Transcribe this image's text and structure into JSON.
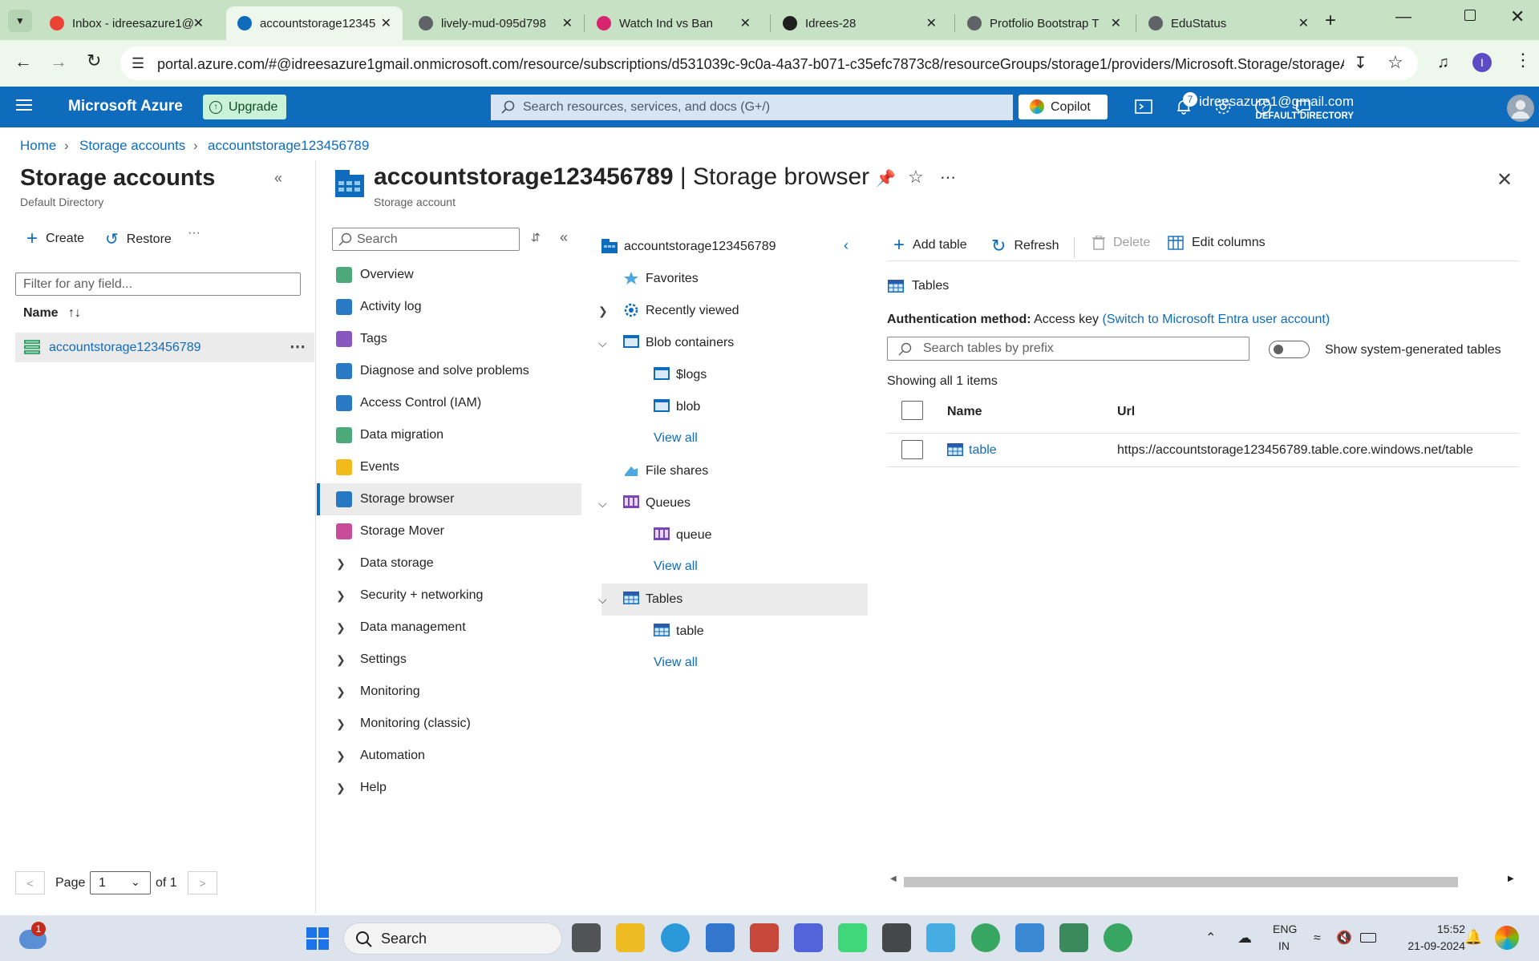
{
  "browser": {
    "tabs": [
      {
        "title": "Inbox - idreesazure1@",
        "fav_color": "#ea4335",
        "active": false
      },
      {
        "title": "accountstorage12345",
        "fav_color": "#0f6cbd",
        "active": true
      },
      {
        "title": "lively-mud-095d798",
        "fav_color": "#5f6368",
        "active": false
      },
      {
        "title": "Watch Ind vs Ban",
        "fav_color": "#d6246e",
        "active": false
      },
      {
        "title": "Idrees-28",
        "fav_color": "#1f1f1f",
        "active": false
      },
      {
        "title": "Protfolio Bootstrap T",
        "fav_color": "#5f6368",
        "active": false
      },
      {
        "title": "EduStatus",
        "fav_color": "#5f6368",
        "active": false
      }
    ],
    "url": "portal.azure.com/#@idreesazure1gmail.onmicrosoft.com/resource/subscriptions/d531039c-9c0a-4a37-b071-c35efc7873c8/resourceGroups/storage1/providers/Microsoft.Storage/storageAcc...",
    "profile_initial": "I"
  },
  "azure": {
    "brand": "Microsoft Azure",
    "upgrade_label": "Upgrade",
    "search_placeholder": "Search resources, services, and docs (G+/)",
    "copilot_label": "Copilot",
    "notification_count": "7",
    "user_email": "idreesazure1@gmail.com",
    "user_directory": "DEFAULT DIRECTORY"
  },
  "breadcrumb": [
    "Home",
    "Storage accounts",
    "accountstorage123456789"
  ],
  "left_panel": {
    "title": "Storage accounts",
    "subtitle": "Default Directory",
    "create_label": "Create",
    "restore_label": "Restore",
    "more_label": "···",
    "filter_placeholder": "Filter for any field...",
    "column_name": "Name",
    "items": [
      "accountstorage123456789"
    ],
    "pagination": {
      "prev": "<",
      "page_label": "Page",
      "page_value": "1",
      "of_label": "of 1",
      "next": ">"
    }
  },
  "resource": {
    "name": "accountstorage123456789",
    "blade": "| Storage browser",
    "type": "Storage account"
  },
  "menu": {
    "search_placeholder": "Search",
    "items": [
      {
        "label": "Overview",
        "icon": "overview-icon",
        "color": "#3a9e6b",
        "expandable": false
      },
      {
        "label": "Activity log",
        "icon": "activity-log-icon",
        "color": "#0f6cbd",
        "expandable": false
      },
      {
        "label": "Tags",
        "icon": "tag-icon",
        "color": "#7a45b8",
        "expandable": false
      },
      {
        "label": "Diagnose and solve problems",
        "icon": "wrench-icon",
        "color": "#0f6cbd",
        "expandable": false
      },
      {
        "label": "Access Control (IAM)",
        "icon": "iam-icon",
        "color": "#0f6cbd",
        "expandable": false
      },
      {
        "label": "Data migration",
        "icon": "data-migration-icon",
        "color": "#3a9e6b",
        "expandable": false
      },
      {
        "label": "Events",
        "icon": "lightning-icon",
        "color": "#f2b400",
        "expandable": false
      },
      {
        "label": "Storage browser",
        "icon": "storage-browser-icon",
        "color": "#0f6cbd",
        "expandable": false,
        "selected": true
      },
      {
        "label": "Storage Mover",
        "icon": "storage-mover-icon",
        "color": "#c2388e",
        "expandable": false
      },
      {
        "label": "Data storage",
        "expandable": true
      },
      {
        "label": "Security + networking",
        "expandable": true
      },
      {
        "label": "Data management",
        "expandable": true
      },
      {
        "label": "Settings",
        "expandable": true
      },
      {
        "label": "Monitoring",
        "expandable": true
      },
      {
        "label": "Monitoring (classic)",
        "expandable": true
      },
      {
        "label": "Automation",
        "expandable": true
      },
      {
        "label": "Help",
        "expandable": true
      }
    ]
  },
  "tree": {
    "root": "accountstorage123456789",
    "favorites": "Favorites",
    "recently_viewed": "Recently viewed",
    "blob_containers": "Blob containers",
    "blob_items": [
      "$logs",
      "blob"
    ],
    "file_shares": "File shares",
    "queues": "Queues",
    "queue_items": [
      "queue"
    ],
    "tables": "Tables",
    "table_items": [
      "table"
    ],
    "view_all": "View all"
  },
  "tables_view": {
    "toolbar": {
      "add": "Add table",
      "refresh": "Refresh",
      "delete": "Delete",
      "edit_columns": "Edit columns"
    },
    "section_label": "Tables",
    "auth_label": "Authentication method:",
    "auth_value": "Access key",
    "auth_link": "(Switch to Microsoft Entra user account)",
    "search_placeholder": "Search tables by prefix",
    "toggle_label": "Show system-generated tables",
    "toggle_on": false,
    "showing": "Showing all 1 items",
    "columns": [
      "Name",
      "Url"
    ],
    "rows": [
      {
        "name": "table",
        "url": "https://accountstorage123456789.table.core.windows.net/table"
      }
    ]
  },
  "taskbar": {
    "weather_badge": "1",
    "search_label": "Search",
    "lang_line1": "ENG",
    "lang_line2": "IN",
    "time": "15:52",
    "date": "21-09-2024"
  }
}
